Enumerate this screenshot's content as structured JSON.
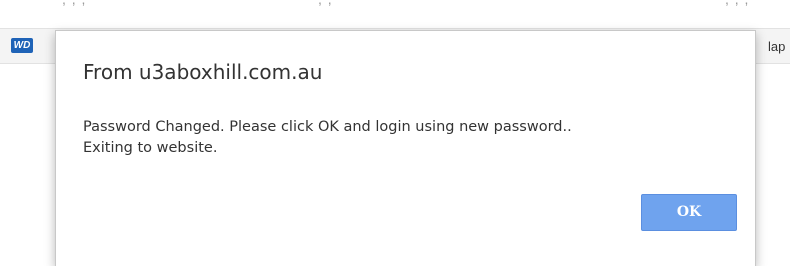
{
  "background": {
    "bookmark_logo_text": "WD",
    "edge_text": "lap"
  },
  "dialog": {
    "title": "From u3aboxhill.com.au",
    "message_line1": "Password Changed. Please click OK and login using new password..",
    "message_line2": "Exiting to website.",
    "ok_label": "OK"
  },
  "colors": {
    "ok_button": "#6fa3ee",
    "wd_logo": "#1f63b7"
  }
}
